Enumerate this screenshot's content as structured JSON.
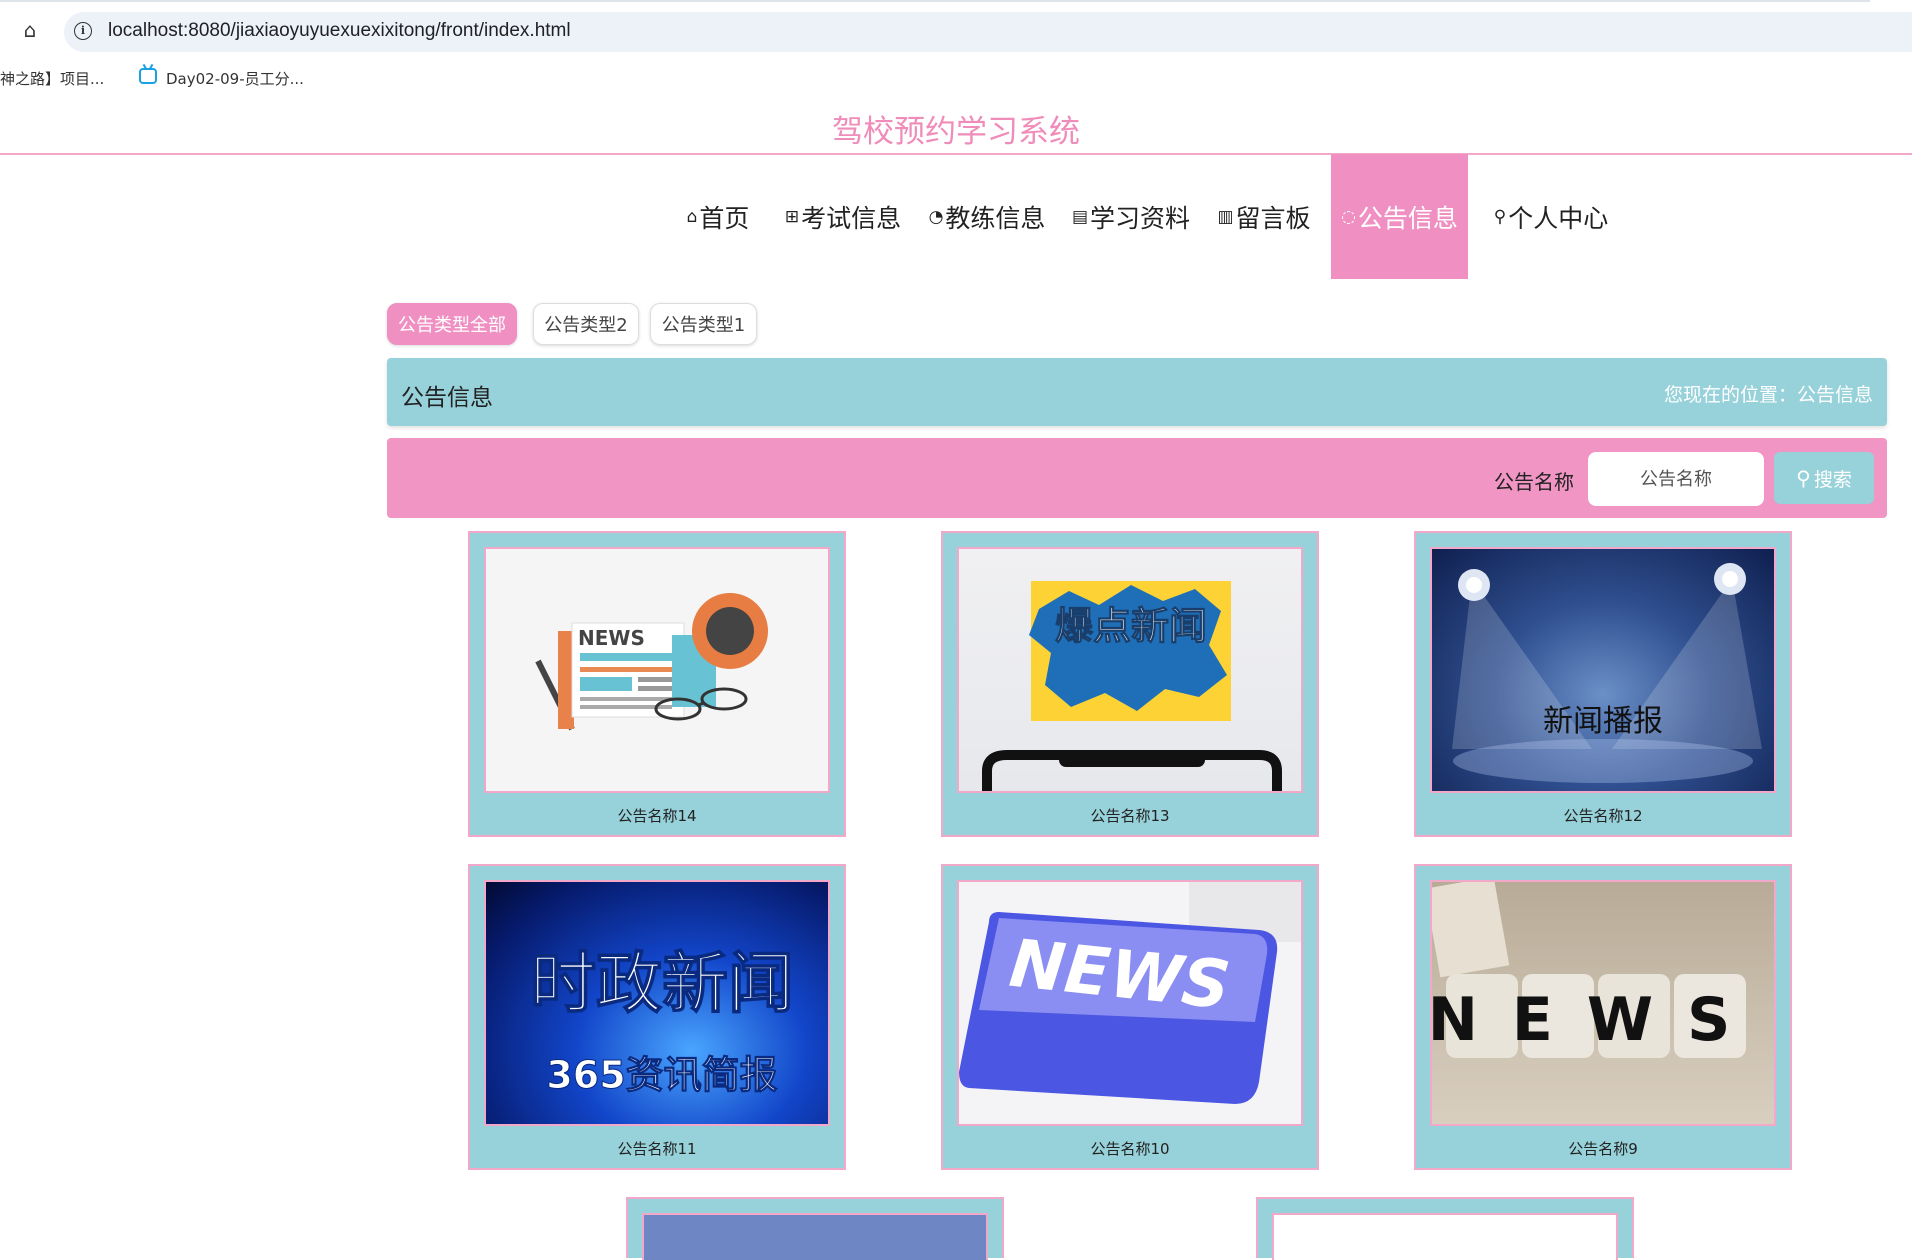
{
  "browser": {
    "url": "localhost:8080/jiaxiaoyuyuexuexixitong/front/index.html",
    "bookmarks": [
      "神之路】项目...",
      "Day02-09-员工分..."
    ]
  },
  "site": {
    "title": "驾校预约学习系统"
  },
  "nav": {
    "items": [
      {
        "icon": "home-icon",
        "label": "首页"
      },
      {
        "icon": "gift-icon",
        "label": "考试信息"
      },
      {
        "icon": "palette-icon",
        "label": "教练信息"
      },
      {
        "icon": "clipboard-icon",
        "label": "学习资料"
      },
      {
        "icon": "book-icon",
        "label": "留言板"
      },
      {
        "icon": "circle-icon",
        "label": "公告信息",
        "active": true
      },
      {
        "icon": "user-icon",
        "label": "个人中心"
      }
    ]
  },
  "tabs": [
    {
      "label": "公告类型全部",
      "active": true
    },
    {
      "label": "公告类型2"
    },
    {
      "label": "公告类型1"
    }
  ],
  "section": {
    "title": "公告信息",
    "breadcrumb": "您现在的位置：公告信息"
  },
  "search": {
    "label": "公告名称",
    "placeholder": "公告名称",
    "button": "搜索"
  },
  "cards": [
    {
      "name": "公告名称14",
      "image_text": "NEWS"
    },
    {
      "name": "公告名称13",
      "image_text": "爆点新闻"
    },
    {
      "name": "公告名称12",
      "image_text": "新闻播报"
    },
    {
      "name": "公告名称11",
      "image_text": "时政新闻",
      "image_subtext": "365资讯简报"
    },
    {
      "name": "公告名称10",
      "image_text": "NEWS"
    },
    {
      "name": "公告名称9",
      "image_text": "NEWS"
    }
  ],
  "colors": {
    "pink": "#f090c2",
    "teal": "#97d1d9",
    "title_pink": "#f08cb9"
  }
}
